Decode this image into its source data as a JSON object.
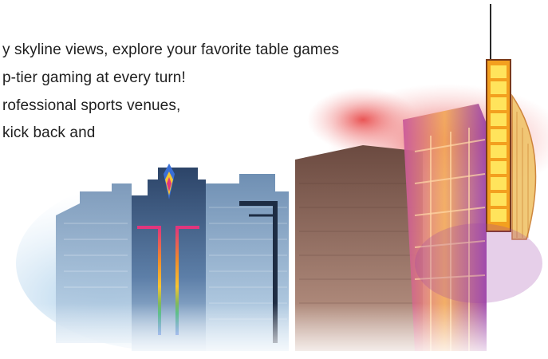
{
  "promo": {
    "lines": [
      "y skyline views, explore your favorite table games",
      "p-tier gaming at every turn!",
      "rofessional sports venues,",
      "kick back and"
    ]
  },
  "colors": {
    "text": "#1f1f1f",
    "sky_wash": "#8fbfe3",
    "red_wash": "#e63a3a",
    "tower_glass": "#3e5f8a",
    "neon_yellow": "#f7c531",
    "neon_pink": "#e0357e",
    "brick": "#7a5548"
  },
  "icons": {
    "building_illustration": "casino-skyline-illustration",
    "crest": "feather-crest-icon"
  }
}
